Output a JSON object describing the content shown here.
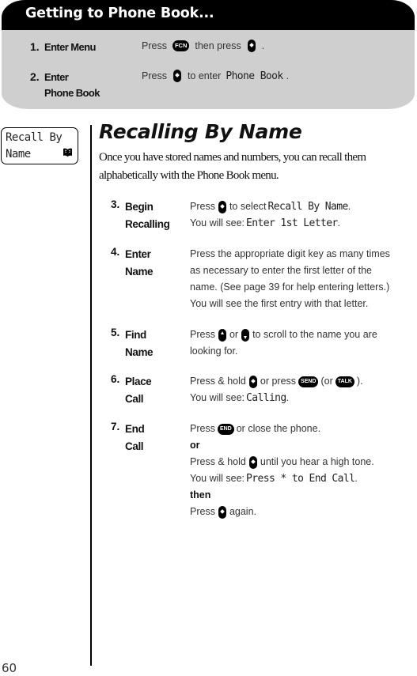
{
  "banner": {
    "title": "Getting to Phone Book...",
    "steps": [
      {
        "number": "1.",
        "label": "Enter Menu",
        "desc_parts": {
          "a": "Press",
          "key1": "FCN",
          "b": "then press",
          "c": "."
        }
      },
      {
        "number": "2.",
        "label": "Enter",
        "label2": "Phone Book",
        "desc_parts": {
          "a": "Press",
          "b": "to enter",
          "display": "Phone Book",
          "c": "."
        }
      }
    ]
  },
  "lcd": {
    "line1": "Recall By",
    "line2": "Name",
    "icon": "book-icon"
  },
  "main": {
    "title": "Recalling By Name",
    "intro": "Once you have stored names and numbers, you can recall them alphabetically with the Phone Book menu.",
    "steps": [
      {
        "number": "3.",
        "label1": "Begin",
        "label2": "Recalling",
        "l1": {
          "a": "Press",
          "b": "to select",
          "display": "Recall By Name",
          "c": "."
        },
        "l2": {
          "a": "You will see:",
          "display": "Enter 1st Letter",
          "c": "."
        }
      },
      {
        "number": "4.",
        "label1": "Enter",
        "label2": "Name",
        "lines": [
          "Press the appropriate digit key as many times",
          "as necessary to enter the first letter of the",
          "name. (See page 39 for help entering letters.)",
          "You will see the first entry with that letter."
        ]
      },
      {
        "number": "5.",
        "label1": "Find",
        "label2": "Name",
        "l1": {
          "a": "Press",
          "b": "or",
          "c": "to scroll to the name you are"
        },
        "l2": "looking for."
      },
      {
        "number": "6.",
        "label1": "Place",
        "label2": "Call",
        "l1": {
          "a": "Press & hold",
          "b": "or press",
          "key_send": "SEND",
          "c": "(or",
          "key_talk": "TALK",
          "d": ")."
        },
        "l2": {
          "a": "You will see:",
          "display": "Calling",
          "c": "."
        }
      },
      {
        "number": "7.",
        "label1": "End",
        "label2": "Call",
        "l1": {
          "a": "Press",
          "key_end": "END",
          "b": "or close the phone."
        },
        "or": "or",
        "l3": {
          "a": "Press & hold",
          "b": "until you hear a high tone."
        },
        "l4": {
          "a": "You will see:",
          "display": "Press * to End Call",
          "c": "."
        },
        "then": "then",
        "l6": {
          "a": "Press",
          "b": "again."
        }
      }
    ]
  },
  "page_number": "60"
}
